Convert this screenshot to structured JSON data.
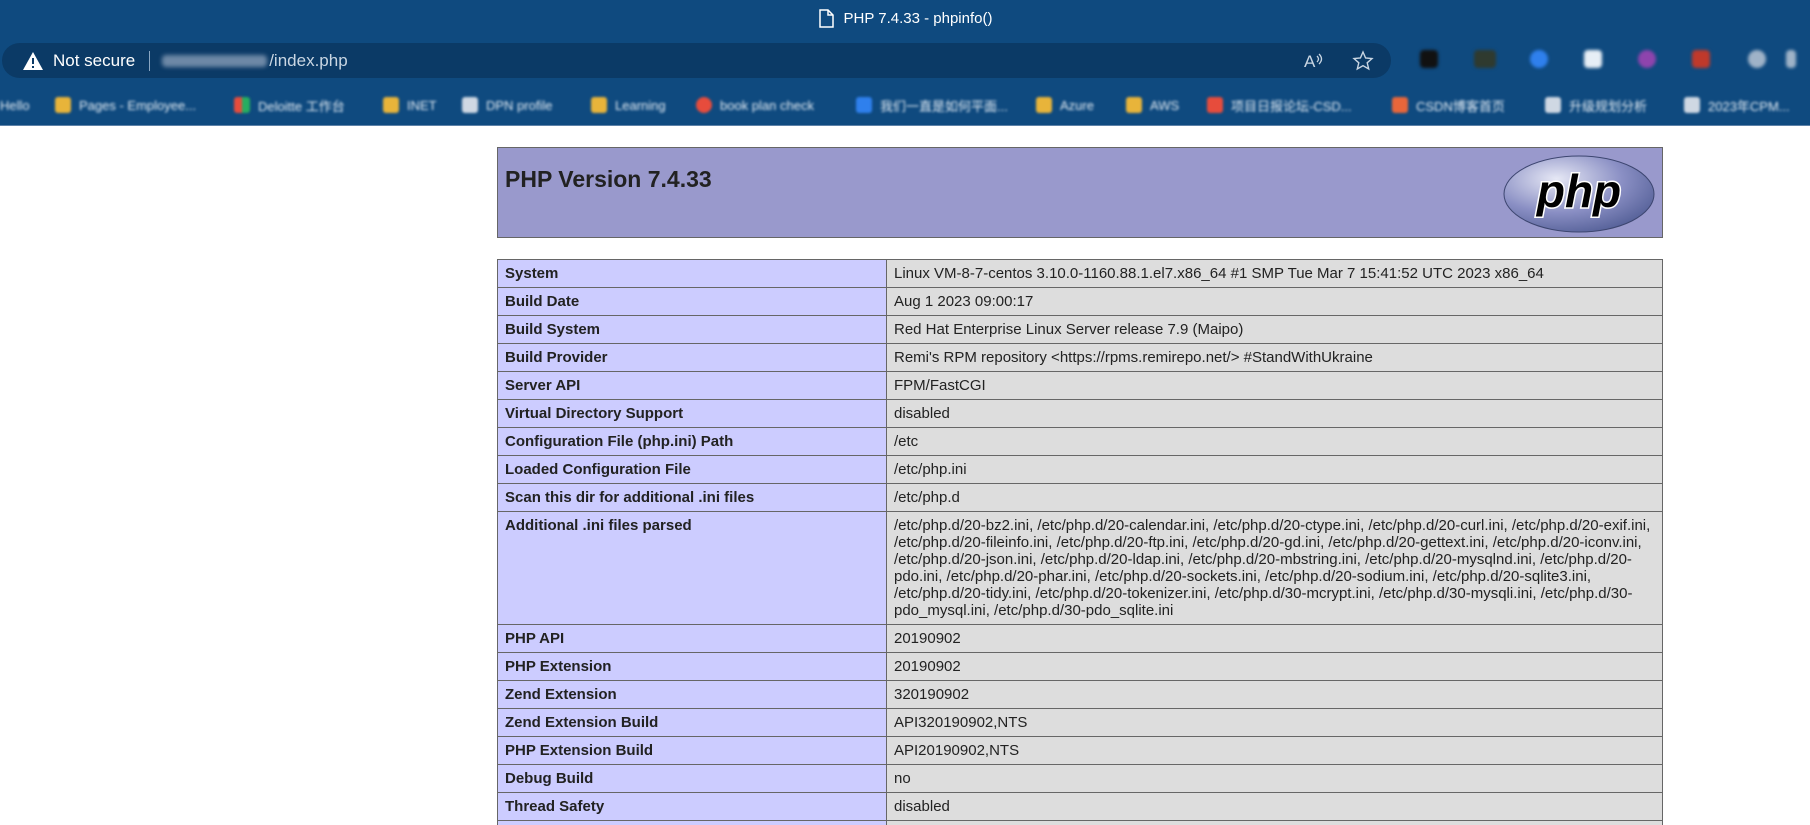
{
  "browser": {
    "window_title": "PHP 7.4.33 - phpinfo()",
    "security_label": "Not secure",
    "url_visible": "/index.php",
    "bookmarks": [
      {
        "label": "Hello",
        "icon": "blurred-text"
      },
      {
        "label": "Pages - Employee...",
        "icon": "folder-icon",
        "color": "#e8b43a"
      },
      {
        "label": "Deloitte 工作台",
        "icon": "windows-logo-icon",
        "color": "#e74c3c"
      },
      {
        "label": "INET",
        "icon": "folder-icon",
        "color": "#e8b43a"
      },
      {
        "label": "DPN profile",
        "icon": "document-icon",
        "color": "#cfd8e3"
      },
      {
        "label": "Learning",
        "icon": "folder-icon",
        "color": "#e8b43a"
      },
      {
        "label": "book plan check",
        "icon": "app-icon",
        "color": "#e74c3c"
      },
      {
        "label": "我们一直是如何平面...",
        "icon": "app-icon",
        "color": "#2f80ed"
      },
      {
        "label": "Azure",
        "icon": "folder-icon",
        "color": "#e8b43a"
      },
      {
        "label": "AWS",
        "icon": "folder-icon",
        "color": "#e8b43a"
      },
      {
        "label": "项目日报论坛-CSD...",
        "icon": "csdn-icon",
        "color": "#e74c3c"
      },
      {
        "label": "CSDN博客首页",
        "icon": "csdn-icon",
        "color": "#e8663a"
      },
      {
        "label": "升级规划分析",
        "icon": "document-icon",
        "color": "#cfd8e3"
      },
      {
        "label": "2023年CPM...",
        "icon": "document-icon",
        "color": "#cfd8e3"
      }
    ]
  },
  "php": {
    "version_title": "PHP Version 7.4.33",
    "logo_text": "php",
    "rows": [
      {
        "key": "System",
        "value": "Linux VM-8-7-centos 3.10.0-1160.88.1.el7.x86_64 #1 SMP Tue Mar 7 15:41:52 UTC 2023 x86_64"
      },
      {
        "key": "Build Date",
        "value": "Aug 1 2023 09:00:17"
      },
      {
        "key": "Build System",
        "value": "Red Hat Enterprise Linux Server release 7.9 (Maipo)"
      },
      {
        "key": "Build Provider",
        "value": "Remi's RPM repository <https://rpms.remirepo.net/> #StandWithUkraine"
      },
      {
        "key": "Server API",
        "value": "FPM/FastCGI"
      },
      {
        "key": "Virtual Directory Support",
        "value": "disabled"
      },
      {
        "key": "Configuration File (php.ini) Path",
        "value": "/etc"
      },
      {
        "key": "Loaded Configuration File",
        "value": "/etc/php.ini"
      },
      {
        "key": "Scan this dir for additional .ini files",
        "value": "/etc/php.d"
      },
      {
        "key": "Additional .ini files parsed",
        "value": "/etc/php.d/20-bz2.ini, /etc/php.d/20-calendar.ini, /etc/php.d/20-ctype.ini, /etc/php.d/20-curl.ini, /etc/php.d/20-exif.ini, /etc/php.d/20-fileinfo.ini, /etc/php.d/20-ftp.ini, /etc/php.d/20-gd.ini, /etc/php.d/20-gettext.ini, /etc/php.d/20-iconv.ini, /etc/php.d/20-json.ini, /etc/php.d/20-ldap.ini, /etc/php.d/20-mbstring.ini, /etc/php.d/20-mysqlnd.ini, /etc/php.d/20-pdo.ini, /etc/php.d/20-phar.ini, /etc/php.d/20-sockets.ini, /etc/php.d/20-sodium.ini, /etc/php.d/20-sqlite3.ini, /etc/php.d/20-tidy.ini, /etc/php.d/20-tokenizer.ini, /etc/php.d/30-mcrypt.ini, /etc/php.d/30-mysqli.ini, /etc/php.d/30-pdo_mysql.ini, /etc/php.d/30-pdo_sqlite.ini"
      },
      {
        "key": "PHP API",
        "value": "20190902"
      },
      {
        "key": "PHP Extension",
        "value": "20190902"
      },
      {
        "key": "Zend Extension",
        "value": "320190902"
      },
      {
        "key": "Zend Extension Build",
        "value": "API320190902,NTS"
      },
      {
        "key": "PHP Extension Build",
        "value": "API20190902,NTS"
      },
      {
        "key": "Debug Build",
        "value": "no"
      },
      {
        "key": "Thread Safety",
        "value": "disabled"
      },
      {
        "key": "",
        "value": ""
      }
    ]
  }
}
